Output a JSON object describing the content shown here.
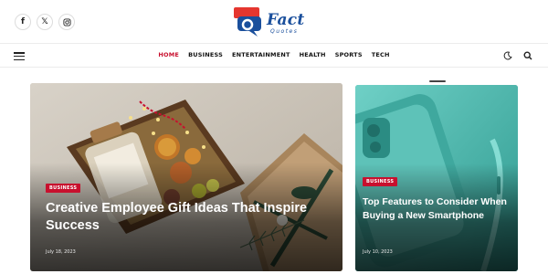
{
  "social": [
    {
      "icon": "facebook-icon",
      "glyph": "f"
    },
    {
      "icon": "x-icon",
      "glyph": "𝕏"
    },
    {
      "icon": "instagram-icon",
      "glyph": "◎"
    }
  ],
  "brand": {
    "name": "Fact",
    "tagline": "Quotes",
    "colors": {
      "blue": "#1a4f9c",
      "red": "#e5362f"
    }
  },
  "nav": {
    "items": [
      "HOME",
      "BUSINESS",
      "ENTERTAINMENT",
      "HEALTH",
      "SPORTS",
      "TECH"
    ],
    "active_index": 0,
    "active_color": "#c8102e"
  },
  "featured": [
    {
      "category": "BUSINESS",
      "title": "Creative Employee Gift Ideas That Inspire Success",
      "date": "July 18, 2023"
    },
    {
      "category": "BUSINESS",
      "title": "Top Features to Consider When Buying a New Smartphone",
      "date": "July 10, 2023"
    }
  ]
}
